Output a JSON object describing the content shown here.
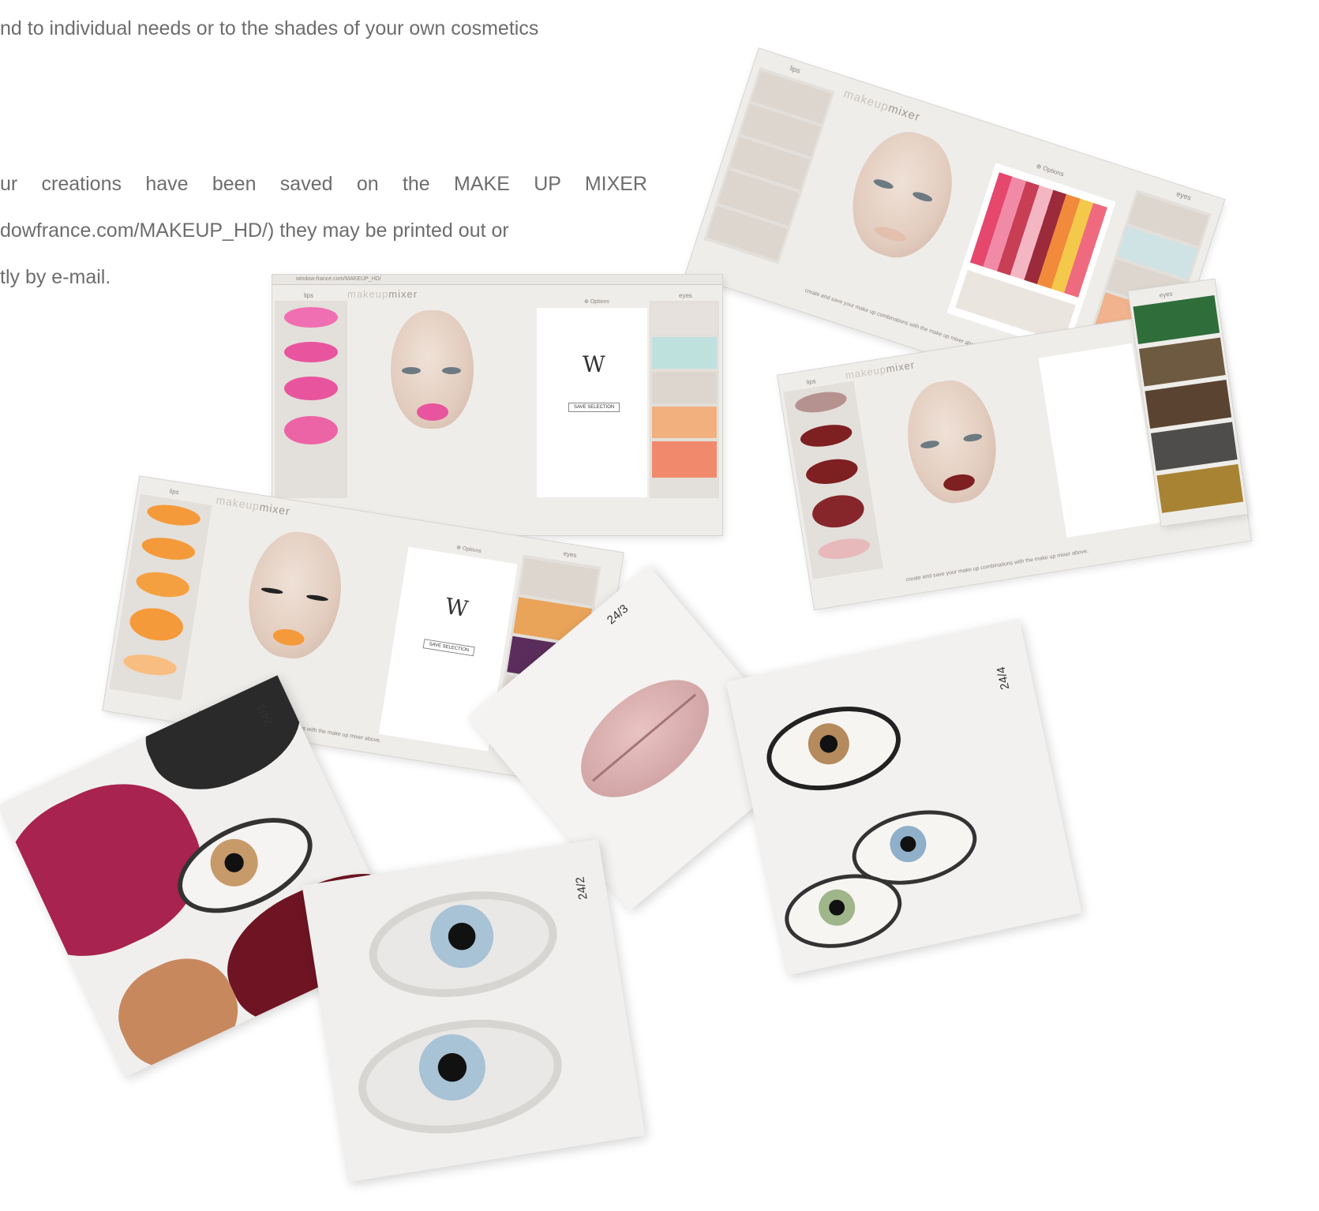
{
  "intro": {
    "line1": "nd to individual needs or to the shades of your own cosmetics",
    "line2": "ur creations have been saved on the MAKE UP MIXER",
    "line3": "dowfrance.com/MAKEUP_HD/) they may be printed out or",
    "line4": "tly by e-mail."
  },
  "app": {
    "brand_light": "makeup",
    "brand_dark": "mixer",
    "lips_label": "lips",
    "eyes_label": "eyes",
    "options_label": "⊕ Options",
    "logo": "W",
    "save_label": "SAVE SELECTION",
    "footer": "create and save your make up combinations with the make up mixer above.",
    "url": "window-france.com/MAKEUP_HD/"
  },
  "photos": {
    "p1": "24/1",
    "p2": "24/2",
    "p3": "24/3",
    "p4": "24/4"
  },
  "colors": {
    "pink_lips": "#e8559e",
    "orange_lips": "#f49a3a",
    "red_lips": "#7e1f22",
    "nude_lips": "#e7b9ba"
  }
}
